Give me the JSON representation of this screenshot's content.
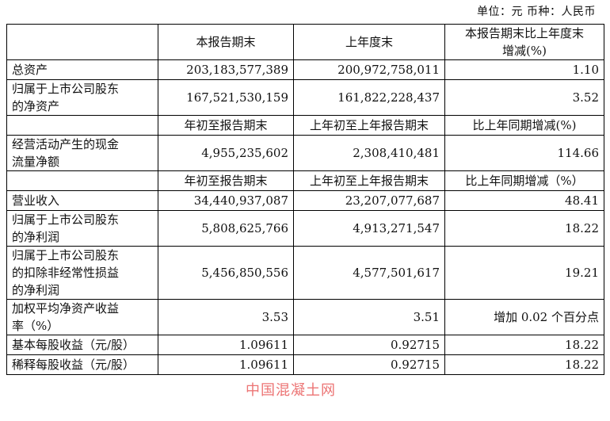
{
  "unit_line": "单位：元   币种：人民币",
  "header": {
    "col1": "本报告期末",
    "col2": "上年度末",
    "col3_line1": "本报告期末比上年度末",
    "col3_line2": "增减(%)"
  },
  "rows": [
    {
      "label": [
        "总资产"
      ],
      "v1": "203,183,577,389",
      "v2": "200,972,758,011",
      "v3": "1.10"
    },
    {
      "label": [
        "归属于上市公司股东",
        "的净资产"
      ],
      "v1": "167,521,530,159",
      "v2": "161,822,228,437",
      "v3": "3.52"
    }
  ],
  "subheader1": {
    "c1": "年初至报告期末",
    "c2": "上年初至上年报告期末",
    "c3": "比上年同期增减(%)"
  },
  "cashflow": {
    "label": [
      "经营活动产生的现金",
      "流量净额"
    ],
    "v1": "4,955,235,602",
    "v2": "2,308,410,481",
    "v3": "114.66"
  },
  "subheader2": {
    "c1": "年初至报告期末",
    "c2": "上年初至上年报告期末",
    "c3": "比上年同期增减（%）"
  },
  "rows2": [
    {
      "label": [
        "营业收入"
      ],
      "v1": "34,440,937,087",
      "v2": "23,207,077,687",
      "v3": "48.41"
    },
    {
      "label": [
        "归属于上市公司股东",
        "的净利润"
      ],
      "v1": "5,808,625,766",
      "v2": "4,913,271,547",
      "v3": "18.22"
    },
    {
      "label": [
        "归属于上市公司股东",
        "的扣除非经常性损益",
        "的净利润"
      ],
      "v1": "5,456,850,556",
      "v2": "4,577,501,617",
      "v3": "19.21"
    },
    {
      "label": [
        "加权平均净资产收益",
        "率（%）"
      ],
      "v1": "3.53",
      "v2": "3.51",
      "v3": "增加 0.02 个百分点"
    },
    {
      "label": [
        "基本每股收益（元/股）"
      ],
      "v1": "1.09611",
      "v2": "0.92715",
      "v3": "18.22"
    },
    {
      "label": [
        "稀释每股收益（元/股）"
      ],
      "v1": "1.09611",
      "v2": "0.92715",
      "v3": "18.22"
    }
  ],
  "watermark": "中国混凝土网"
}
